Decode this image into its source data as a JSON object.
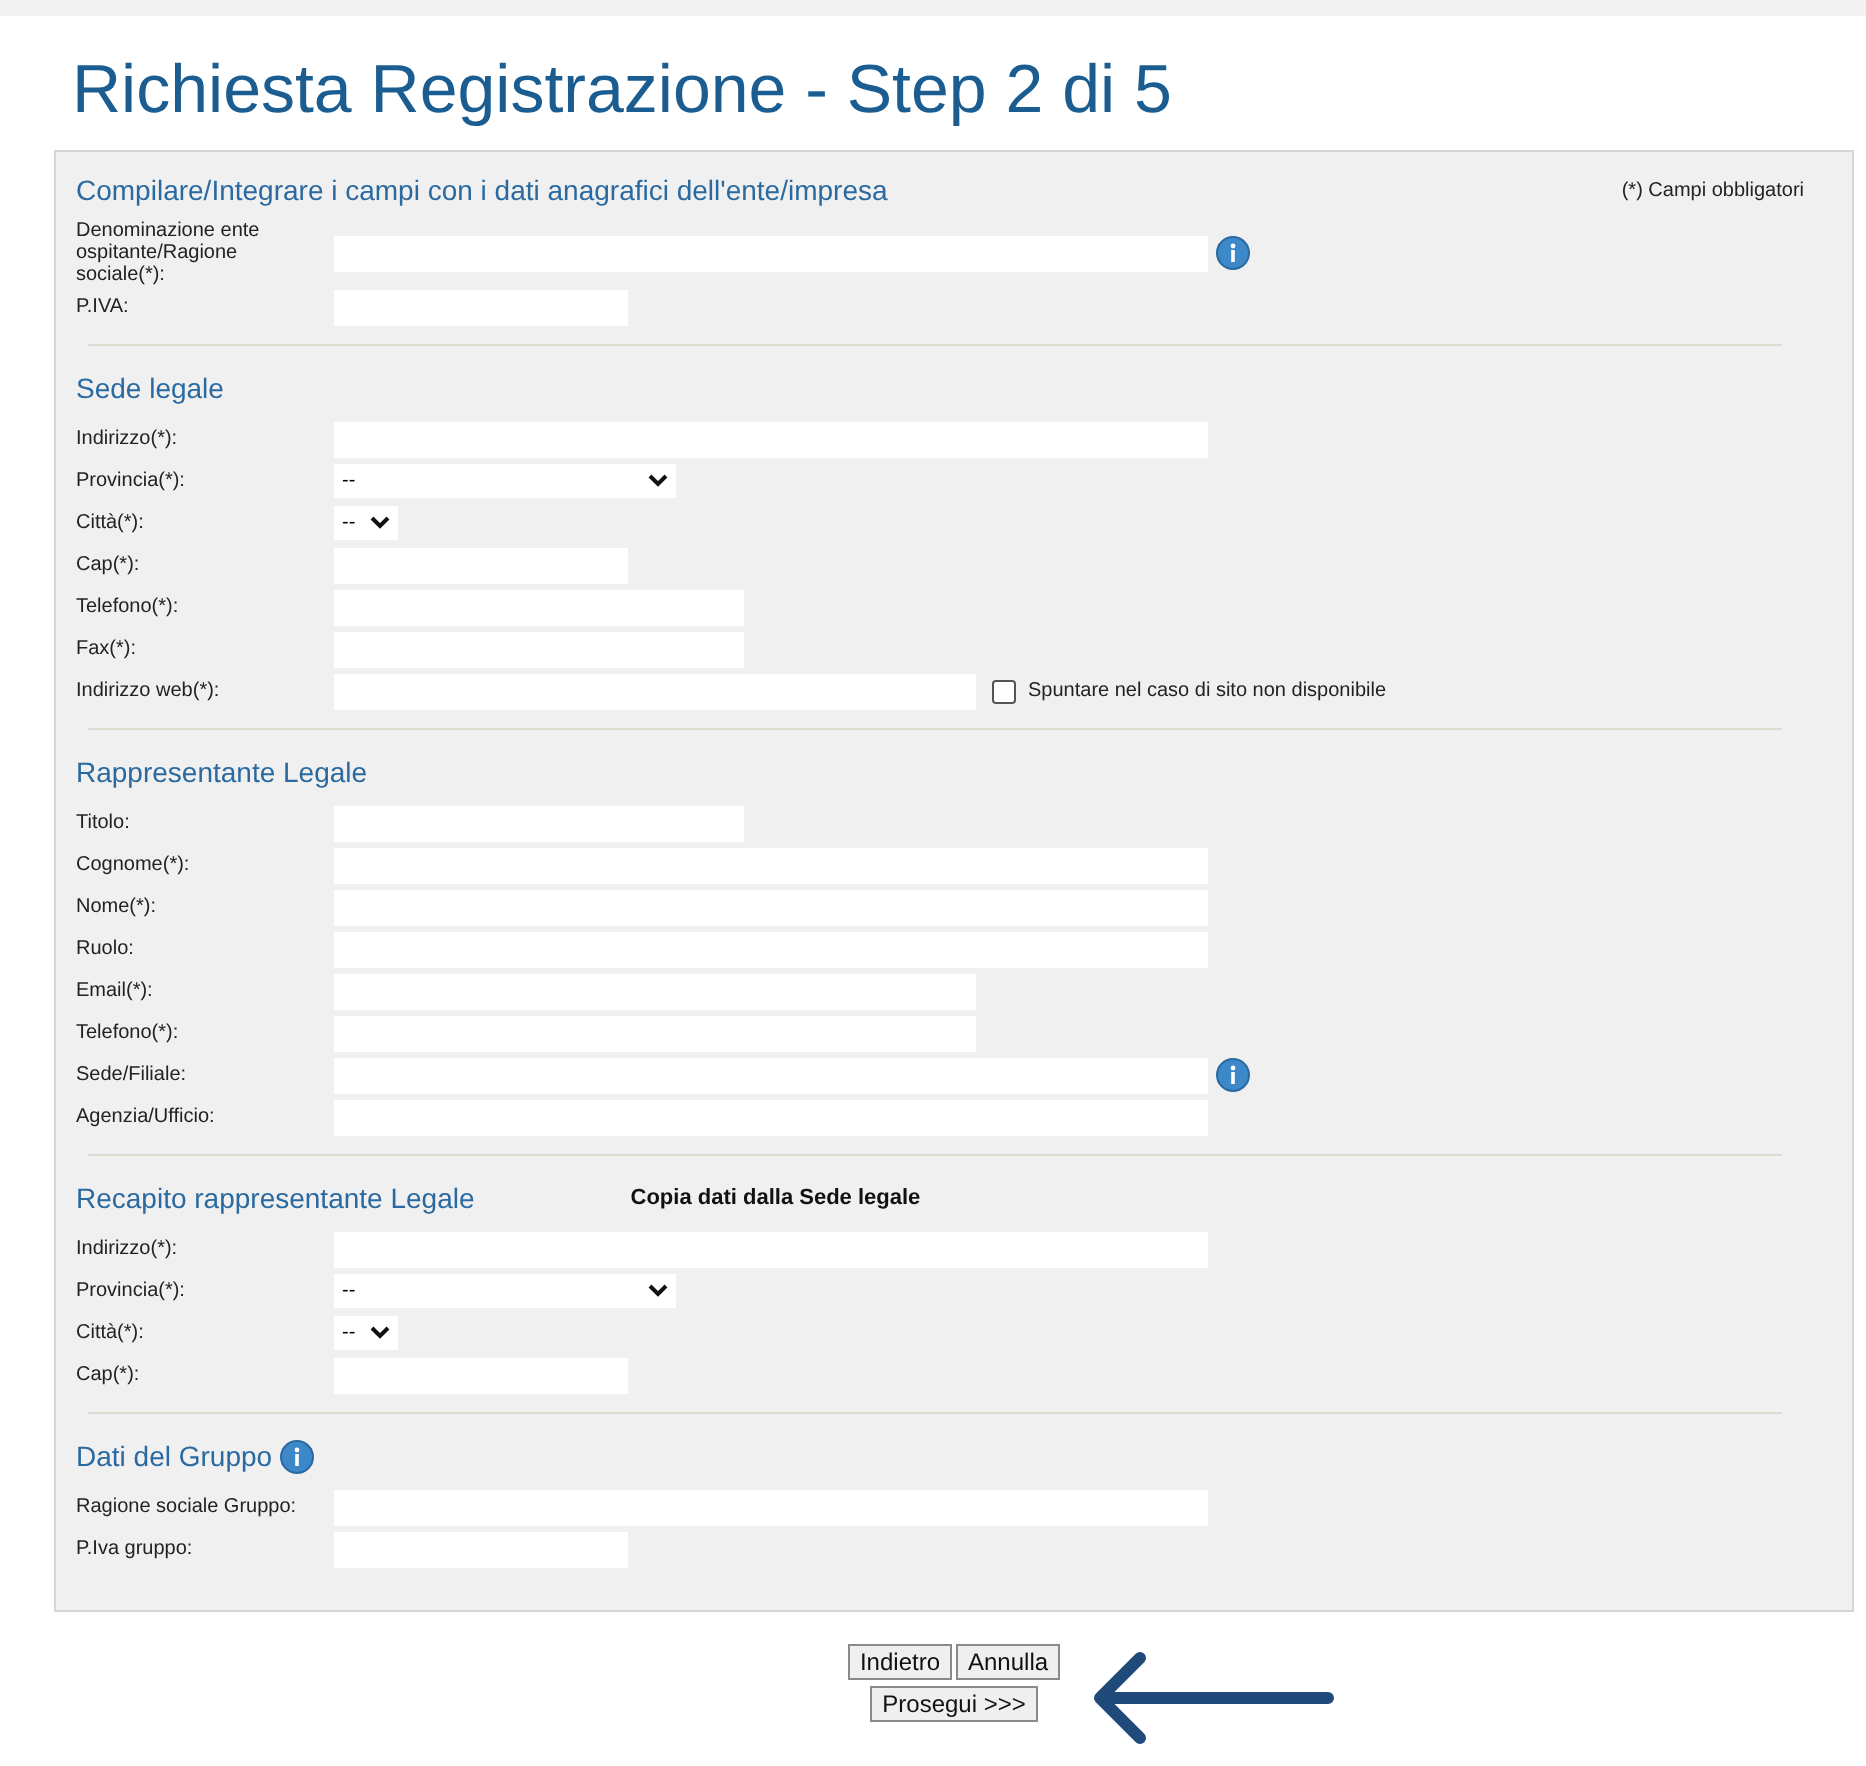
{
  "page_title": "Richiesta Registrazione - Step 2 di 5",
  "sections": [
    {
      "heading": "Compilare/Integrare i campi con i dati anagrafici dell'ente/impresa",
      "note": {
        "kind": "hint",
        "text": "(*) Campi obbligatori"
      },
      "fields": [
        {
          "label": "Denominazione ente ospitante/Ragione sociale(*):",
          "kind": "long",
          "info": true
        },
        {
          "label": "P.IVA:",
          "kind": "short"
        }
      ]
    },
    {
      "heading": "Sede legale",
      "fields": [
        {
          "label": "Indirizzo(*):",
          "kind": "long"
        },
        {
          "label": "Provincia(*):",
          "kind": "select",
          "value": "--"
        },
        {
          "label": "Città(*):",
          "kind": "minselect",
          "value": "--"
        },
        {
          "label": "Cap(*):",
          "kind": "short"
        },
        {
          "label": "Telefono(*):",
          "kind": "medium"
        },
        {
          "label": "Fax(*):",
          "kind": "medium"
        },
        {
          "label": "Indirizzo web(*):",
          "kind": "wide",
          "checkbox": {
            "label": "Spuntare nel caso di sito non disponibile",
            "checked": false
          }
        }
      ]
    },
    {
      "heading": "Rappresentante Legale",
      "fields": [
        {
          "label": "Titolo:",
          "kind": "medium"
        },
        {
          "label": "Cognome(*):",
          "kind": "long"
        },
        {
          "label": "Nome(*):",
          "kind": "long"
        },
        {
          "label": "Ruolo:",
          "kind": "long"
        },
        {
          "label": "Email(*):",
          "kind": "wide"
        },
        {
          "label": "Telefono(*):",
          "kind": "wide"
        },
        {
          "label": "Sede/Filiale:",
          "kind": "long",
          "info": true
        },
        {
          "label": "Agenzia/Ufficio:",
          "kind": "long"
        }
      ]
    },
    {
      "heading": "Recapito rappresentante Legale",
      "note": {
        "kind": "link",
        "text": "Copia dati dalla Sede legale"
      },
      "fields": [
        {
          "label": "Indirizzo(*):",
          "kind": "long"
        },
        {
          "label": "Provincia(*):",
          "kind": "select",
          "value": "--"
        },
        {
          "label": "Città(*):",
          "kind": "minselect",
          "value": "--"
        },
        {
          "label": "Cap(*):",
          "kind": "short"
        }
      ]
    },
    {
      "heading": "Dati del Gruppo",
      "info": true,
      "fields": [
        {
          "label": "Ragione sociale Gruppo:",
          "kind": "long"
        },
        {
          "label": "P.Iva gruppo:",
          "kind": "short"
        }
      ]
    }
  ],
  "buttons": [
    [
      "Indietro",
      "Annulla"
    ],
    [
      "Prosegui >>>"
    ]
  ]
}
